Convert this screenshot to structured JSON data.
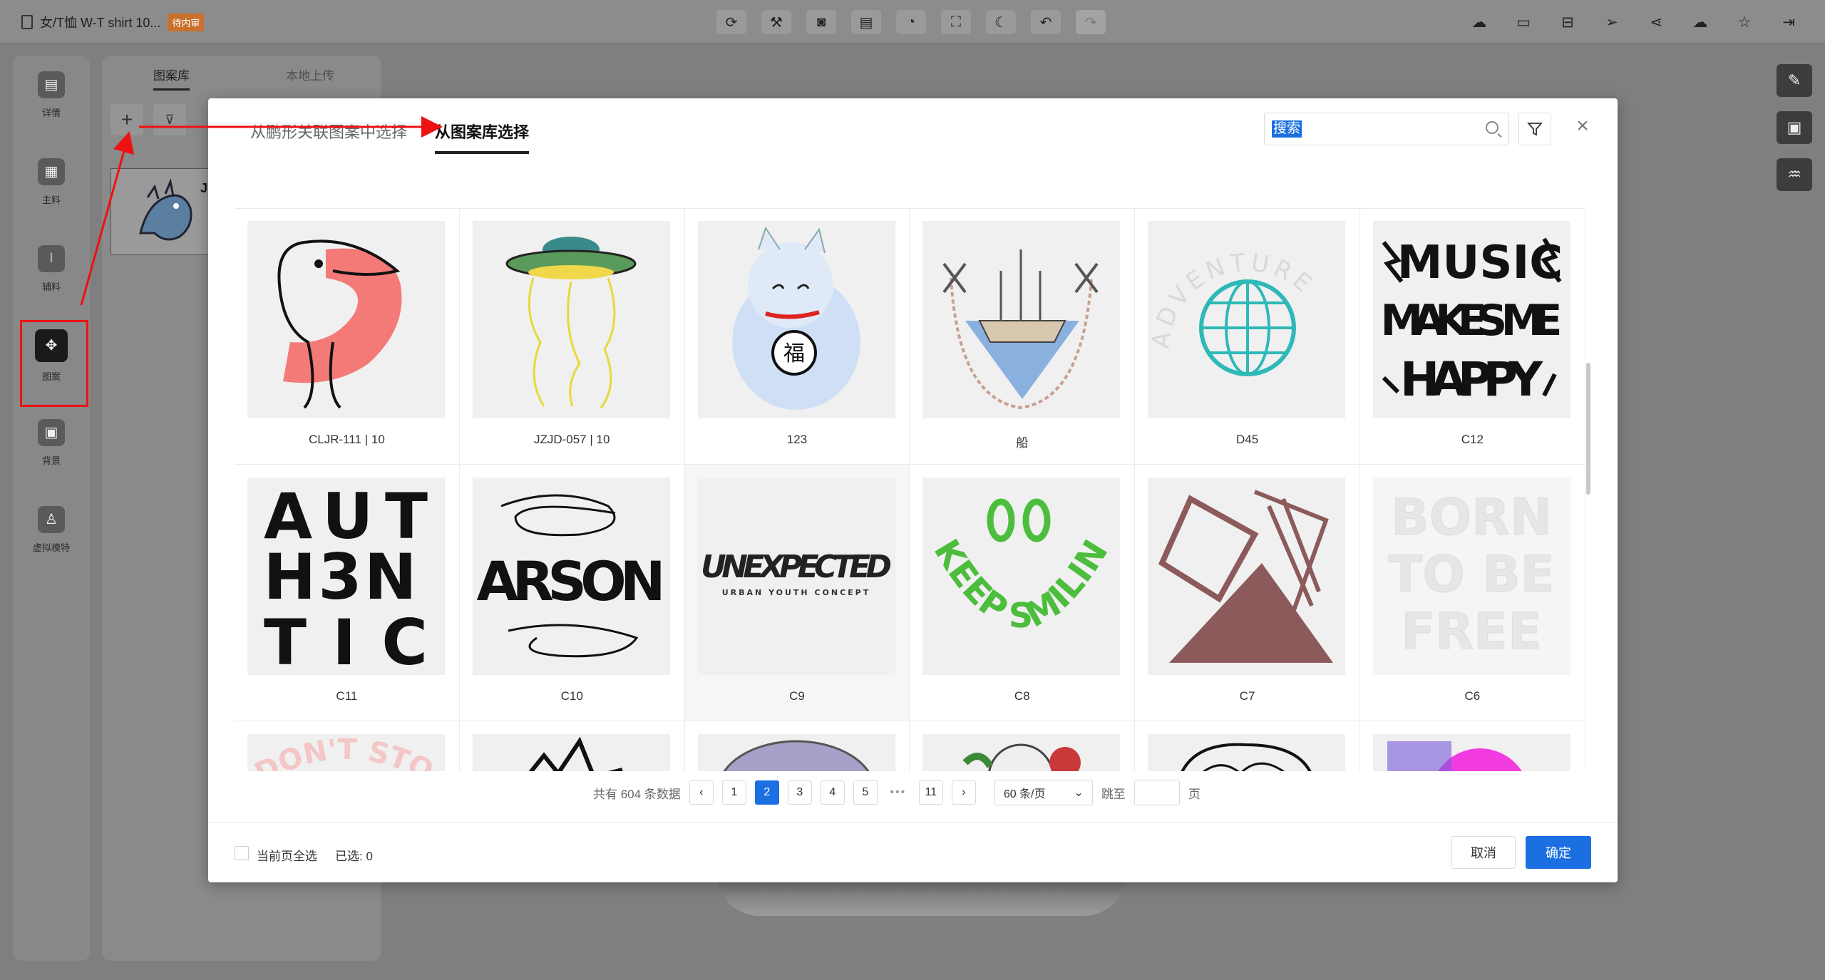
{
  "app": {
    "doc_title": "女/T恤 W-T shirt 10...",
    "status_badge": "待内审"
  },
  "left_rail": {
    "items": [
      {
        "label": "详情",
        "icon": "detail-icon"
      },
      {
        "label": "主料",
        "icon": "fabric-icon"
      },
      {
        "label": "辅料",
        "icon": "accessory-icon"
      },
      {
        "label": "图案",
        "icon": "pattern-icon"
      },
      {
        "label": "背景",
        "icon": "background-icon"
      },
      {
        "label": "虚拟模特",
        "icon": "model-icon"
      }
    ]
  },
  "side_panel": {
    "tabs": [
      "图案库",
      "本地上传"
    ],
    "thumb_label": "J"
  },
  "modal": {
    "tabs": [
      "从鹏形关联图案中选择",
      "从图案库选择"
    ],
    "search_value": "搜索",
    "items": [
      {
        "label": "CLJR-111 | 10"
      },
      {
        "label": "JZJD-057 | 10"
      },
      {
        "label": "123"
      },
      {
        "label": "船"
      },
      {
        "label": "D45"
      },
      {
        "label": "C12"
      },
      {
        "label": "C11"
      },
      {
        "label": "C10"
      },
      {
        "label": "C9"
      },
      {
        "label": "C8"
      },
      {
        "label": "C7"
      },
      {
        "label": "C6"
      },
      {
        "label": ""
      },
      {
        "label": ""
      },
      {
        "label": ""
      },
      {
        "label": ""
      },
      {
        "label": ""
      },
      {
        "label": ""
      }
    ],
    "art_text": {
      "music": [
        "MUSIC",
        "MAKES ME",
        "HAPPY"
      ],
      "authentic": [
        "AUT",
        "H3N",
        "TIC"
      ],
      "arson": "ARSON",
      "unexpected": "UNEXPECTED",
      "unexpected_sub": "URBAN YOUTH CONCEPT",
      "smile": "KEEP SMILING",
      "adventure": "ADVENTURE",
      "born": [
        "BORN",
        "TO BE",
        "FREE"
      ],
      "dont_stop": "DON'T STOP"
    },
    "pagination": {
      "total": "共有 604 条数据",
      "pages": [
        "1",
        "2",
        "3",
        "4",
        "5",
        "•••",
        "11"
      ],
      "active_page": "2",
      "page_size": "60 条/页",
      "jump_label": "跳至",
      "page_suffix": "页"
    },
    "footer": {
      "select_all": "当前页全选",
      "selected": "已选: 0",
      "cancel": "取消",
      "confirm": "确定"
    }
  }
}
